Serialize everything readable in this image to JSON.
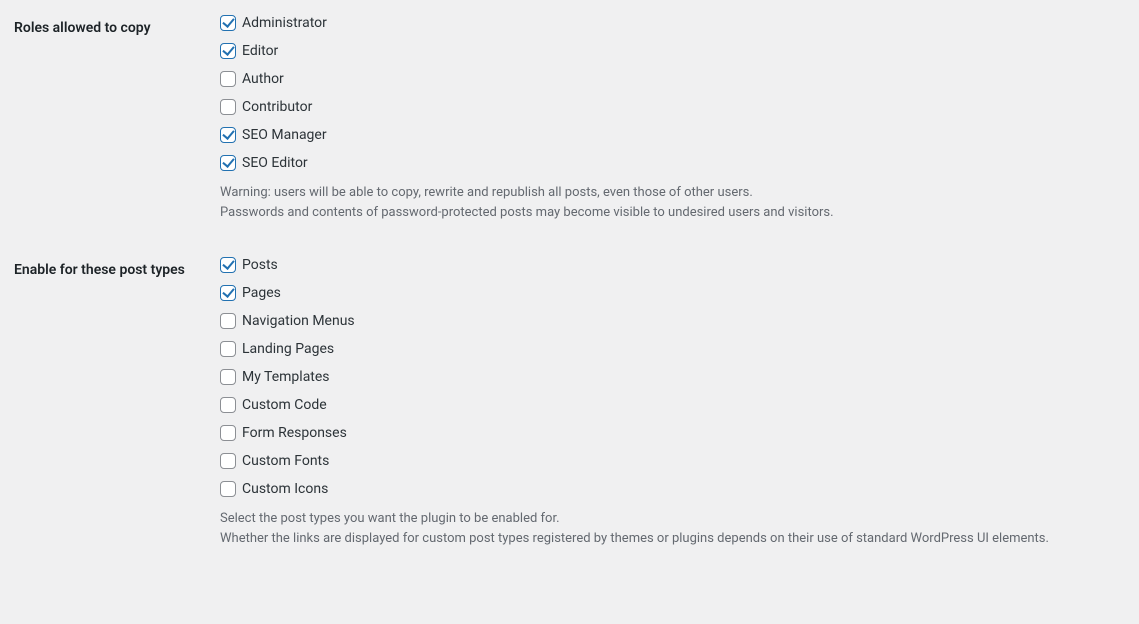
{
  "roles": {
    "heading": "Roles allowed to copy",
    "items": [
      {
        "label": "Administrator",
        "checked": true
      },
      {
        "label": "Editor",
        "checked": true
      },
      {
        "label": "Author",
        "checked": false
      },
      {
        "label": "Contributor",
        "checked": false
      },
      {
        "label": "SEO Manager",
        "checked": true
      },
      {
        "label": "SEO Editor",
        "checked": true
      }
    ],
    "desc_line1": "Warning: users will be able to copy, rewrite and republish all posts, even those of other users.",
    "desc_line2": "Passwords and contents of password-protected posts may become visible to undesired users and visitors."
  },
  "postTypes": {
    "heading": "Enable for these post types",
    "items": [
      {
        "label": "Posts",
        "checked": true
      },
      {
        "label": "Pages",
        "checked": true
      },
      {
        "label": "Navigation Menus",
        "checked": false
      },
      {
        "label": "Landing Pages",
        "checked": false
      },
      {
        "label": "My Templates",
        "checked": false
      },
      {
        "label": "Custom Code",
        "checked": false
      },
      {
        "label": "Form Responses",
        "checked": false
      },
      {
        "label": "Custom Fonts",
        "checked": false
      },
      {
        "label": "Custom Icons",
        "checked": false
      }
    ],
    "desc_line1": "Select the post types you want the plugin to be enabled for.",
    "desc_line2": "Whether the links are displayed for custom post types registered by themes or plugins depends on their use of standard WordPress UI elements."
  }
}
